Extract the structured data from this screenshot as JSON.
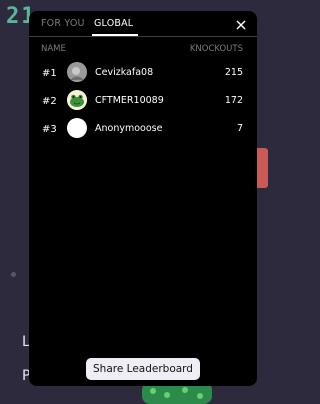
{
  "background": {
    "score_text": "21",
    "letters": [
      "L",
      "P"
    ]
  },
  "leaderboard": {
    "tabs": [
      {
        "label": "FOR YOU",
        "active": false
      },
      {
        "label": "GLOBAL",
        "active": true
      }
    ],
    "columns": {
      "name": "NAME",
      "knockouts": "KNOCKOUTS"
    },
    "rows": [
      {
        "rank": "#1",
        "name": "Cevizkafa08",
        "knockouts": "215",
        "avatar": "gray-avatar-icon"
      },
      {
        "rank": "#2",
        "name": "CFTMER10089",
        "knockouts": "172",
        "avatar": "green-frog-avatar-icon"
      },
      {
        "rank": "#3",
        "name": "Anonymooose",
        "knockouts": "7",
        "avatar": "blank-avatar-icon"
      }
    ],
    "share_label": "Share Leaderboard"
  },
  "colors": {
    "page_bg": "#2e2a3e",
    "modal_bg": "#000000",
    "accent_green": "#57b79a"
  }
}
